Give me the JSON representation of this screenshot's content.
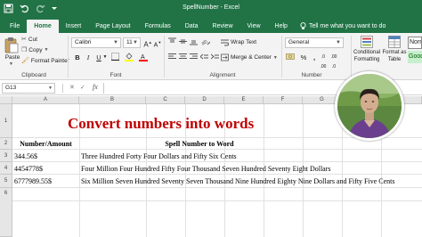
{
  "window": {
    "title": "SpellNumber  -  Excel"
  },
  "ribbon_tabs": [
    "File",
    "Home",
    "Insert",
    "Page Layout",
    "Formulas",
    "Data",
    "Review",
    "View",
    "Help"
  ],
  "active_tab": "Home",
  "tell_me": "Tell me what you want to do",
  "clipboard": {
    "paste": "Paste",
    "cut": "Cut",
    "copy": "Copy",
    "format_painter": "Format Painter",
    "group_label": "Clipboard"
  },
  "font": {
    "name": "Calibri",
    "size": "11",
    "group_label": "Font"
  },
  "alignment": {
    "wrap_text": "Wrap Text",
    "merge_center": "Merge & Center",
    "group_label": "Alignment"
  },
  "number": {
    "format": "General",
    "group_label": "Number"
  },
  "styles": {
    "conditional_formatting_1": "Conditional",
    "conditional_formatting_2": "Formatting",
    "format_as_table_1": "Format as",
    "format_as_table_2": "Table",
    "style_normal": "Norm",
    "style_good": "Good"
  },
  "formula_bar": {
    "name_box": "G13",
    "fx": "fx"
  },
  "columns": [
    "A",
    "B",
    "C",
    "D",
    "E",
    "F",
    "G",
    "H",
    "I"
  ],
  "rows": [
    "1",
    "2",
    "3",
    "4",
    "5",
    "6"
  ],
  "sheet": {
    "title": "Convert numbers into words",
    "header_a": "Number/Amount",
    "header_b": "Spell Number to Word",
    "data": [
      {
        "amount": "344.56$",
        "words": "Three Hundred Forty Four Dollars and Fifty Six Cents"
      },
      {
        "amount": "4454778$",
        "words": "Four Million Four Hundred Fifty Four Thousand Seven Hundred Seventy Eight Dollars"
      },
      {
        "amount": "6777989.55$",
        "words": "Six Million Seven Hundred Seventy Seven Thousand Nine Hundred Eighty Nine Dollars and Fifty Five Cents"
      }
    ]
  },
  "colors": {
    "excel_green": "#217346",
    "title_red": "#c00000",
    "good_style_bg": "#c6efce",
    "good_style_text": "#006100"
  }
}
